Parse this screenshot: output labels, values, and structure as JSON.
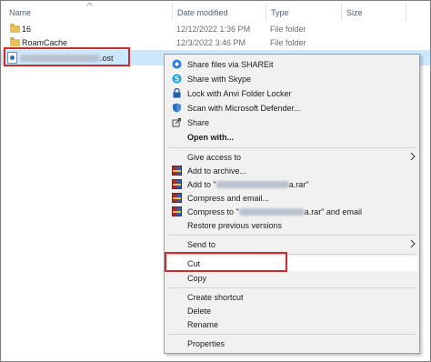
{
  "columns": {
    "name": "Name",
    "date": "Date modified",
    "type": "Type",
    "size": "Size"
  },
  "files": [
    {
      "name": "16",
      "date": "12/12/2022 1:36 PM",
      "type": "File folder"
    },
    {
      "name": "RoamCache",
      "date": "12/3/2022 3:46 PM",
      "type": "File folder"
    }
  ],
  "selected_file": {
    "extension": ".ost"
  },
  "menu": {
    "share_shareit": "Share files via SHAREit",
    "share_skype": "Share with Skype",
    "lock_anvi": "Lock with Anvi Folder Locker",
    "scan_defender": "Scan with Microsoft Defender...",
    "share": "Share",
    "open_with": "Open with...",
    "give_access": "Give access to",
    "add_archive": "Add to archive...",
    "add_to_prefix": "Add to \"",
    "add_to_suffix": "a.rar\"",
    "compress_email": "Compress and email...",
    "compress_to_prefix": "Compress to \"",
    "compress_to_suffix": "a.rar\" and email",
    "restore": "Restore previous versions",
    "send_to": "Send to",
    "cut": "Cut",
    "copy": "Copy",
    "create_shortcut": "Create shortcut",
    "delete": "Delete",
    "rename": "Rename",
    "properties": "Properties"
  },
  "icons": {
    "shareit": "shareit-icon",
    "skype": "skype-icon",
    "anvi": "lock-icon",
    "defender": "shield-icon",
    "share": "share-icon",
    "rar": "winrar-icon"
  },
  "colors": {
    "highlight_box": "#d12a2a",
    "selection": "#cce8ff",
    "menu_bg": "#f1f1f1"
  }
}
